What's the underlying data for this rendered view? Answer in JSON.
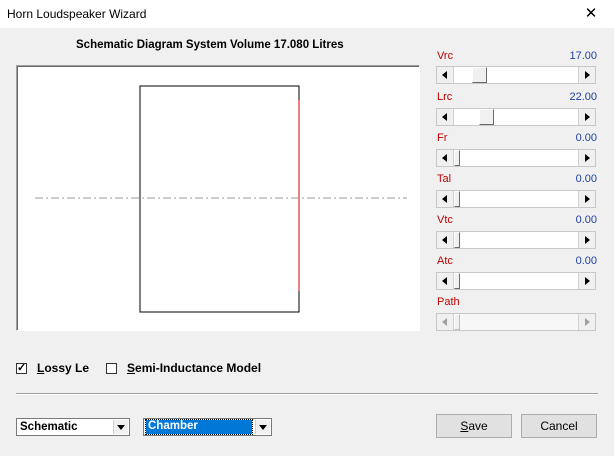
{
  "window": {
    "title": "Horn Loudspeaker Wizard",
    "close_glyph": "✕"
  },
  "diagram": {
    "heading": "Schematic Diagram   System Volume 17.080 Litres"
  },
  "params": [
    {
      "label": "Vrc",
      "value": "17.00",
      "level": 0.15
    },
    {
      "label": "Lrc",
      "value": "22.00",
      "level": 0.2
    },
    {
      "label": "Fr",
      "value": "0.00",
      "level": 0
    },
    {
      "label": "Tal",
      "value": "0.00",
      "level": 0
    },
    {
      "label": "Vtc",
      "value": "0.00",
      "level": 0
    },
    {
      "label": "Atc",
      "value": "0.00",
      "level": 0
    },
    {
      "label": "Path",
      "value": "",
      "level": 0,
      "disabled": true
    }
  ],
  "options": {
    "lossy_le": {
      "label": "Lossy Le",
      "checked": true
    },
    "semi_inductance": {
      "label": "Semi-Inductance Model",
      "checked": false
    }
  },
  "selectors": {
    "view": "Schematic",
    "section": "Chamber"
  },
  "buttons": {
    "save": "Save",
    "cancel": "Cancel"
  },
  "colors": {
    "label_red": "#c00000",
    "value_blue": "#1f3fa0",
    "selection": "#0078d7"
  },
  "icons": {
    "close": "close-icon",
    "check": "check-icon"
  }
}
